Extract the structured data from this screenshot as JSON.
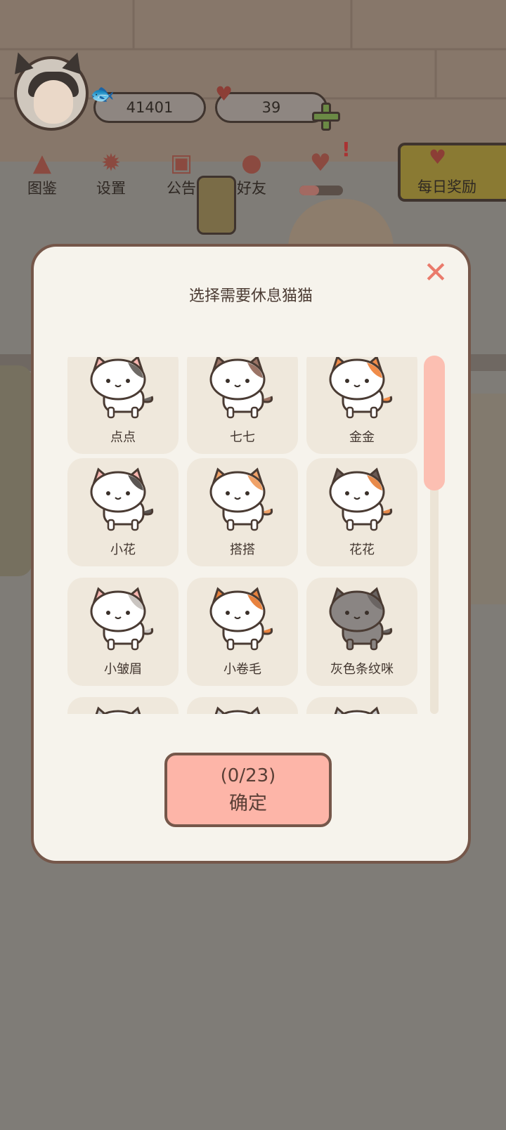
{
  "header": {
    "fish_count": "41401",
    "heart_count": "39",
    "menu": [
      {
        "label": "图鉴",
        "icon": "cat-book-icon"
      },
      {
        "label": "设置",
        "icon": "gear-icon"
      },
      {
        "label": "公告",
        "icon": "gift-icon"
      },
      {
        "label": "好友",
        "icon": "friends-icon"
      }
    ],
    "daily_reward_label": "每日奖励"
  },
  "dialog": {
    "title": "选择需要休息猫猫",
    "close_icon": "close-icon",
    "cats": [
      {
        "name": "点点",
        "colors": {
          "body": "#ffffff",
          "patch": "#6f6a66",
          "ears": "#f7b6b0"
        }
      },
      {
        "name": "七七",
        "colors": {
          "body": "#ffffff",
          "patch": "#9b7466",
          "ears": "#9b7466"
        }
      },
      {
        "name": "金金",
        "colors": {
          "body": "#ffffff",
          "patch": "#f08c4a",
          "ears": "#f08c4a"
        }
      },
      {
        "name": "小花",
        "colors": {
          "body": "#ffffff",
          "patch": "#5a5552",
          "ears": "#f7b6b0"
        }
      },
      {
        "name": "搭搭",
        "colors": {
          "body": "#ffffff",
          "patch": "#f0a268",
          "ears": "#f0a268"
        }
      },
      {
        "name": "花花",
        "colors": {
          "body": "#ffffff",
          "patch": "#e88a4a",
          "ears": "#6a5a54"
        }
      },
      {
        "name": "小皱眉",
        "colors": {
          "body": "#ffffff",
          "patch": "#c9c4c0",
          "ears": "#f7b6b0"
        }
      },
      {
        "name": "小卷毛",
        "colors": {
          "body": "#ffffff",
          "patch": "#e8823e",
          "ears": "#e8823e"
        }
      },
      {
        "name": "灰色条纹咪",
        "colors": {
          "body": "#8a8583",
          "patch": "#6a6462",
          "ears": "#6a6462"
        }
      },
      {
        "name": "",
        "colors": {
          "body": "#ffffff",
          "patch": "#cccccc",
          "ears": "#cccccc"
        }
      },
      {
        "name": "",
        "colors": {
          "body": "#ffffff",
          "patch": "#cccccc",
          "ears": "#cccccc"
        }
      },
      {
        "name": "",
        "colors": {
          "body": "#ffffff",
          "patch": "#cccccc",
          "ears": "#cccccc"
        }
      }
    ],
    "selected_count": "(0/23)",
    "confirm_label": "确定"
  },
  "colors": {
    "accent_pink": "#fdb5a8",
    "close_red": "#ea7a6b",
    "modal_bg": "#f6f3ec",
    "card_bg": "#efe8dc",
    "border_brown": "#75574a"
  }
}
